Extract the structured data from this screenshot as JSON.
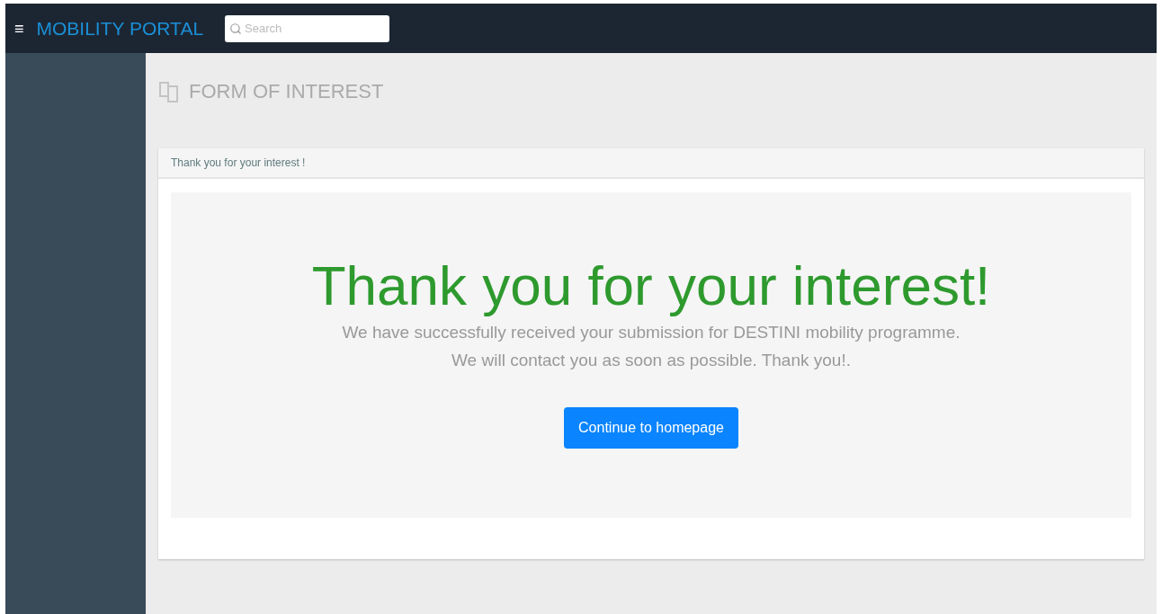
{
  "topbar": {
    "menu_glyph": "≡",
    "brand": "MOBILITY PORTAL",
    "search": {
      "placeholder": "Search"
    }
  },
  "page": {
    "title": "FORM OF INTEREST"
  },
  "panel": {
    "heading": "Thank you for your interest !",
    "headline": "Thank you for your interest!",
    "lines": [
      "We have successfully received your submission for DESTINI mobility programme.",
      "We will contact you as soon as possible. Thank you!."
    ],
    "button": "Continue to homepage"
  }
}
